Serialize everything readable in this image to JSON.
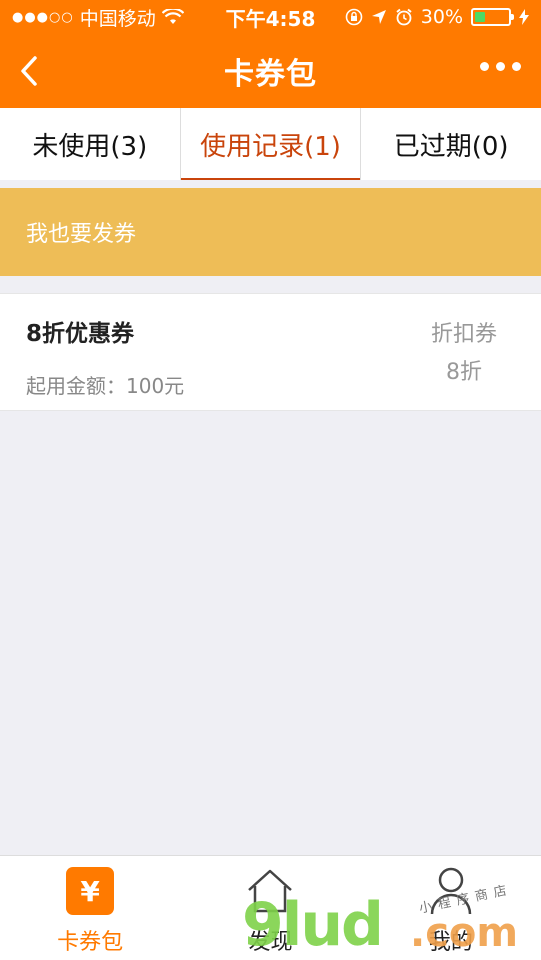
{
  "status_bar": {
    "signal_dots": "●●●○○",
    "carrier": "中国移动",
    "time": "下午4:58",
    "battery_percent": "30%",
    "battery_level": 0.3
  },
  "nav": {
    "title": "卡券包"
  },
  "tabs": [
    {
      "label": "未使用(3)"
    },
    {
      "label": "使用记录(1)"
    },
    {
      "label": "已过期(0)"
    }
  ],
  "banner": {
    "label": "我也要发券"
  },
  "coupon": {
    "name": "8折优惠券",
    "min_amount": "起用金额：100元",
    "type": "折扣券",
    "value": "8折"
  },
  "tabbar": [
    {
      "label": "卡券包",
      "icon": "coupon-icon"
    },
    {
      "label": "发现",
      "icon": "home-icon"
    },
    {
      "label": "我的",
      "icon": "person-icon"
    }
  ],
  "watermark": {
    "main": "9lud",
    "suffix": ".com",
    "sub": "小程序商店"
  },
  "colors": {
    "brand": "#ff7a00",
    "active_tab": "#c9440b",
    "banner": "#eebd57",
    "battery": "#4cd964"
  }
}
